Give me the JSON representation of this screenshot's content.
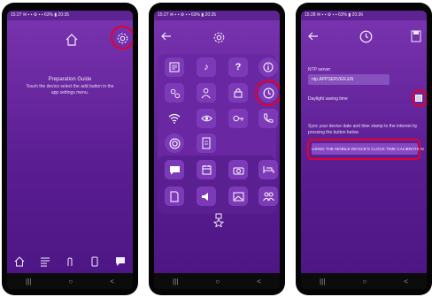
{
  "phones": [
    {
      "status_bar": "15:27 ✉ ▪ ▪ ⚙ ▪ ▪ 63% ▮ 20:35",
      "guide_title": "Preparation Guide",
      "guide_text": "Touch the device select the add button in the app settings menu.",
      "nav": {
        "recent": "|||",
        "home": "○",
        "back": "<"
      }
    },
    {
      "status_bar": "15:27 ✉ ▪ ▪ ⚙ ▪ ▪ 63% ▮ 20:35",
      "tiles_row1": [
        "♪",
        "?"
      ],
      "nav": {
        "recent": "|||",
        "home": "○",
        "back": "<"
      }
    },
    {
      "status_bar": "15:28 ✉ ▪ ▪ ⚙ ▪ ▪ 63% ▮ 20:36",
      "ntp_label": "NTP server",
      "ntp_value": "ntp.APPSERVER.EN",
      "daylight_label": "Daylight saving time",
      "sync_text": "Sync your device date and time stamp to the internet by pressing the button below",
      "sync_button": "USING THE MOBILE DEVICE'S CLOCK TIME CALIBRATION",
      "nav": {
        "recent": "|||",
        "home": "○",
        "back": "<"
      }
    }
  ],
  "colors": {
    "accent_highlight": "#e5002d",
    "background": "#5a1d92"
  }
}
